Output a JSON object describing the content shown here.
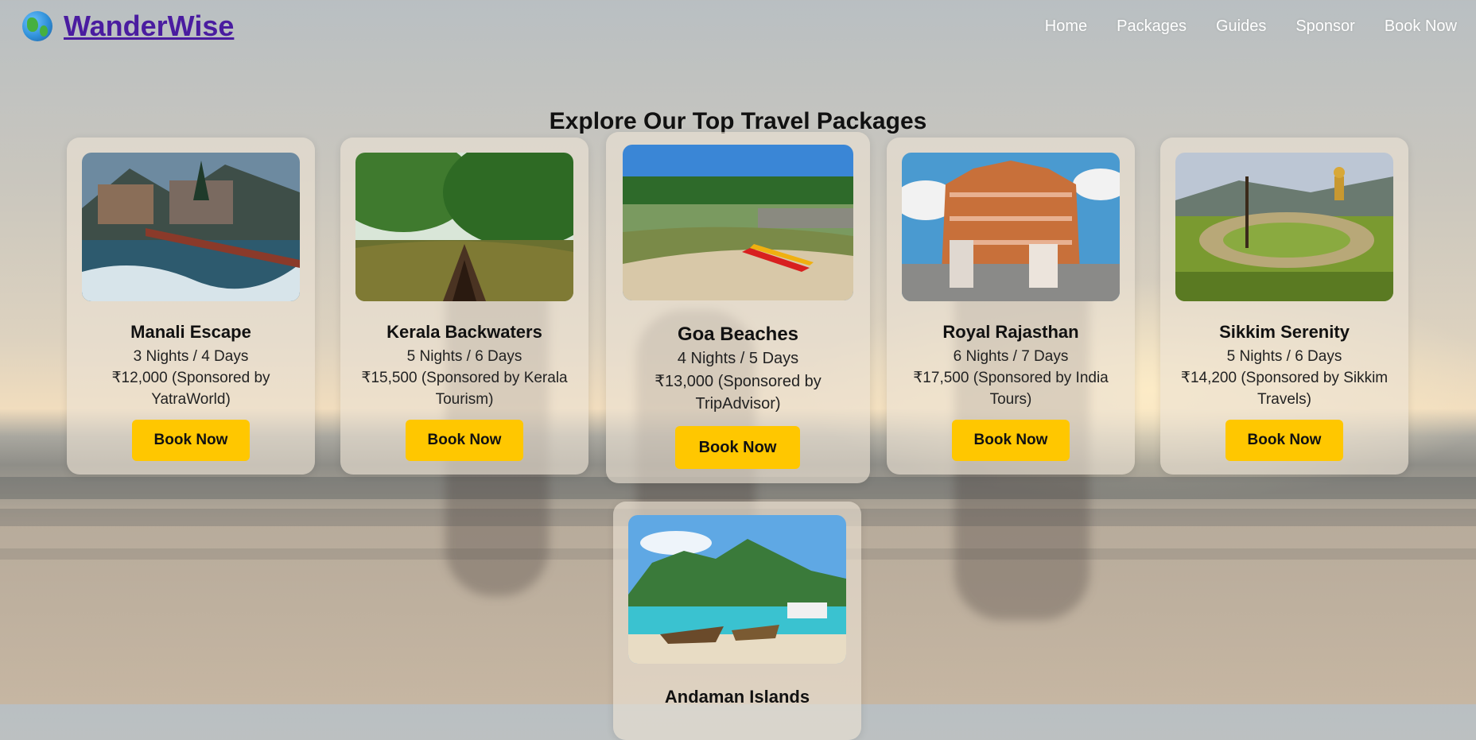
{
  "brand": {
    "name": "WanderWise",
    "icon": "globe-icon"
  },
  "nav": [
    "Home",
    "Packages",
    "Guides",
    "Sponsor",
    "Book Now"
  ],
  "section_title": "Explore Our Top Travel Packages",
  "packages": [
    {
      "title": "Manali Escape",
      "duration": "3 Nights / 4 Days",
      "price": "₹12,000 (Sponsored by YatraWorld)",
      "button": "Book Now"
    },
    {
      "title": "Kerala Backwaters",
      "duration": "5 Nights / 6 Days",
      "price": "₹15,500 (Sponsored by Kerala Tourism)",
      "button": "Book Now"
    },
    {
      "title": "Goa Beaches",
      "duration": "4 Nights / 5 Days",
      "price": "₹13,000 (Sponsored by TripAdvisor)",
      "button": "Book Now"
    },
    {
      "title": "Royal Rajasthan",
      "duration": "6 Nights / 7 Days",
      "price": "₹17,500 (Sponsored by India Tours)",
      "button": "Book Now"
    },
    {
      "title": "Sikkim Serenity",
      "duration": "5 Nights / 6 Days",
      "price": "₹14,200 (Sponsored by Sikkim Travels)",
      "button": "Book Now"
    },
    {
      "title": "Andaman Islands"
    }
  ],
  "colors": {
    "brand": "#4a1ca0",
    "button": "#ffc700",
    "nav_text": "#ffffff"
  }
}
